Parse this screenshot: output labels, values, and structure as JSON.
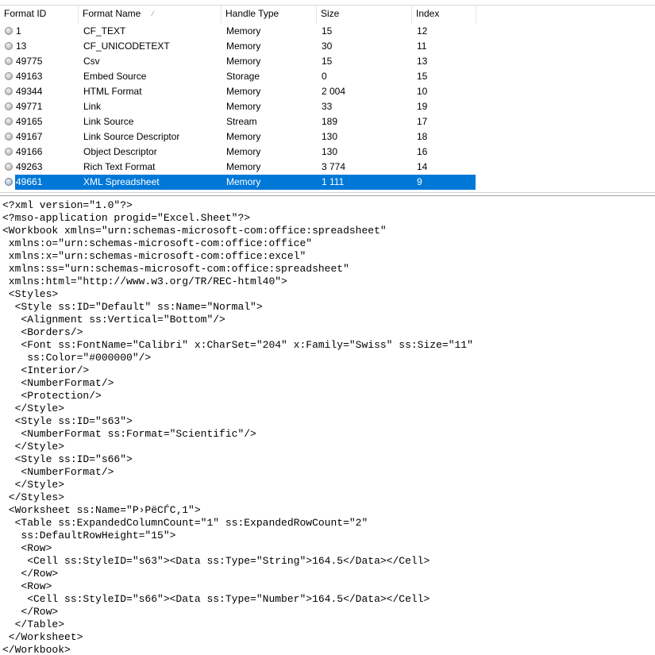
{
  "list": {
    "columns": [
      {
        "key": "format_id",
        "label": "Format ID"
      },
      {
        "key": "format_name",
        "label": "Format Name",
        "sort_indicator": "⁄"
      },
      {
        "key": "handle_type",
        "label": "Handle Type"
      },
      {
        "key": "size",
        "label": "Size"
      },
      {
        "key": "index",
        "label": "Index"
      }
    ],
    "selected_row": 10,
    "colors": {
      "selection": "#0078d7",
      "selection_text": "#ffffff",
      "icon": "gray-circle-icon"
    },
    "rows": [
      {
        "format_id": "1",
        "format_name": "CF_TEXT",
        "handle_type": "Memory",
        "size": "15",
        "index": "12"
      },
      {
        "format_id": "13",
        "format_name": "CF_UNICODETEXT",
        "handle_type": "Memory",
        "size": "30",
        "index": "11"
      },
      {
        "format_id": "49775",
        "format_name": "Csv",
        "handle_type": "Memory",
        "size": "15",
        "index": "13"
      },
      {
        "format_id": "49163",
        "format_name": "Embed Source",
        "handle_type": "Storage",
        "size": "0",
        "index": "15"
      },
      {
        "format_id": "49344",
        "format_name": "HTML Format",
        "handle_type": "Memory",
        "size": "2 004",
        "index": "10"
      },
      {
        "format_id": "49771",
        "format_name": "Link",
        "handle_type": "Memory",
        "size": "33",
        "index": "19"
      },
      {
        "format_id": "49165",
        "format_name": "Link Source",
        "handle_type": "Stream",
        "size": "189",
        "index": "17"
      },
      {
        "format_id": "49167",
        "format_name": "Link Source Descriptor",
        "handle_type": "Memory",
        "size": "130",
        "index": "18"
      },
      {
        "format_id": "49166",
        "format_name": "Object Descriptor",
        "handle_type": "Memory",
        "size": "130",
        "index": "16"
      },
      {
        "format_id": "49263",
        "format_name": "Rich Text Format",
        "handle_type": "Memory",
        "size": "3 774",
        "index": "14"
      },
      {
        "format_id": "49661",
        "format_name": "XML Spreadsheet",
        "handle_type": "Memory",
        "size": "1 111",
        "index": "9"
      }
    ]
  },
  "content": {
    "text": "<?xml version=\"1.0\"?>\n<?mso-application progid=\"Excel.Sheet\"?>\n<Workbook xmlns=\"urn:schemas-microsoft-com:office:spreadsheet\"\n xmlns:o=\"urn:schemas-microsoft-com:office:office\"\n xmlns:x=\"urn:schemas-microsoft-com:office:excel\"\n xmlns:ss=\"urn:schemas-microsoft-com:office:spreadsheet\"\n xmlns:html=\"http://www.w3.org/TR/REC-html40\">\n <Styles>\n  <Style ss:ID=\"Default\" ss:Name=\"Normal\">\n   <Alignment ss:Vertical=\"Bottom\"/>\n   <Borders/>\n   <Font ss:FontName=\"Calibri\" x:CharSet=\"204\" x:Family=\"Swiss\" ss:Size=\"11\"\n    ss:Color=\"#000000\"/>\n   <Interior/>\n   <NumberFormat/>\n   <Protection/>\n  </Style>\n  <Style ss:ID=\"s63\">\n   <NumberFormat ss:Format=\"Scientific\"/>\n  </Style>\n  <Style ss:ID=\"s66\">\n   <NumberFormat/>\n  </Style>\n </Styles>\n <Worksheet ss:Name=\"Р›РёСЃС‚1\">\n  <Table ss:ExpandedColumnCount=\"1\" ss:ExpandedRowCount=\"2\"\n   ss:DefaultRowHeight=\"15\">\n   <Row>\n    <Cell ss:StyleID=\"s63\"><Data ss:Type=\"String\">164.5</Data></Cell>\n   </Row>\n   <Row>\n    <Cell ss:StyleID=\"s66\"><Data ss:Type=\"Number\">164.5</Data></Cell>\n   </Row>\n  </Table>\n </Worksheet>\n</Workbook>"
  }
}
